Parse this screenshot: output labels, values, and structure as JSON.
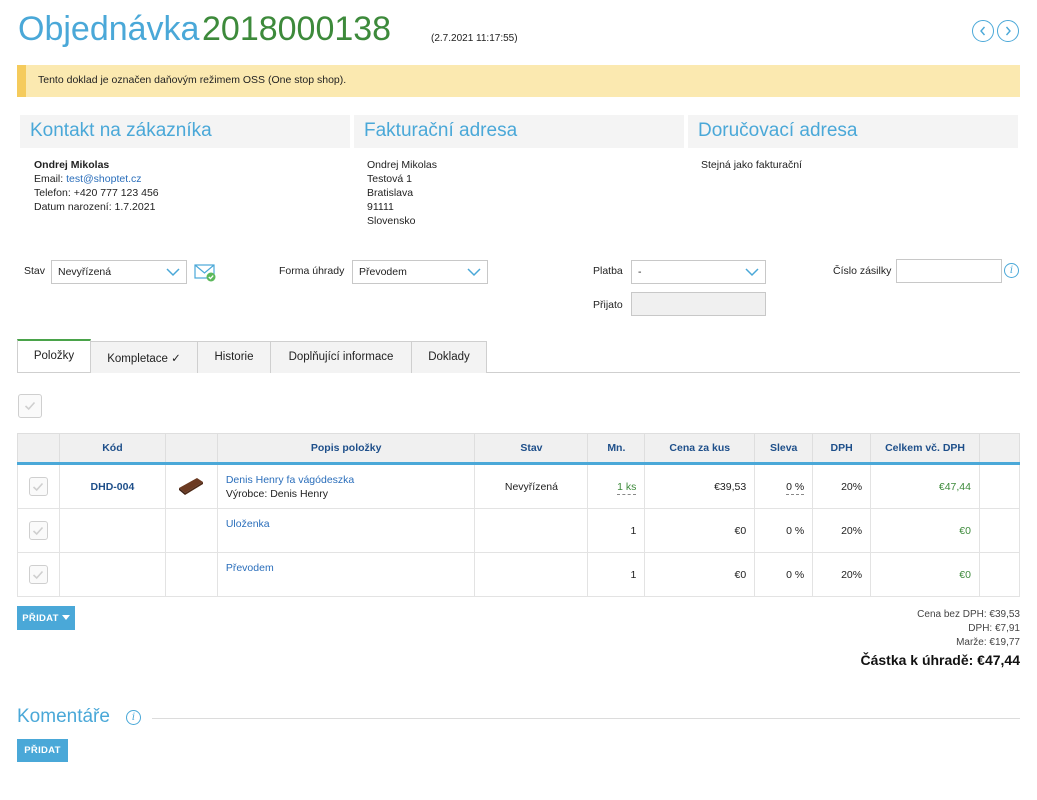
{
  "header": {
    "title_word": "Objednávka",
    "order_number": "2018000138",
    "datetime": "(2.7.2021 11:17:55)"
  },
  "notice": "Tento doklad je označen daňovým režimem OSS (One stop shop).",
  "contact": {
    "heading": "Kontakt na zákazníka",
    "name": "Ondrej Mikolas",
    "email_label": "Email: ",
    "email": "test@shoptet.cz",
    "phone": "Telefon: +420 777 123 456",
    "birth": "Datum narození: 1.7.2021"
  },
  "billing": {
    "heading": "Fakturační adresa",
    "lines": [
      "Ondrej Mikolas",
      "Testová 1",
      "Bratislava",
      "91111",
      "Slovensko"
    ]
  },
  "delivery": {
    "heading": "Doručovací adresa",
    "text": "Stejná jako fakturační"
  },
  "form": {
    "status_label": "Stav",
    "status_value": "Nevyřízená",
    "payment_form_label": "Forma úhrady",
    "payment_form_value": "Převodem",
    "payment_label": "Platba",
    "payment_value": "-",
    "received_label": "Přijato",
    "received_value": "",
    "tracking_label": "Číslo zásilky",
    "tracking_value": ""
  },
  "tabs": [
    "Položky",
    "Kompletace ✓",
    "Historie",
    "Doplňující informace",
    "Doklady"
  ],
  "table": {
    "headers": [
      "",
      "Kód",
      "",
      "Popis položky",
      "Stav",
      "Mn.",
      "Cena za kus",
      "Sleva",
      "DPH",
      "Celkem vč. DPH",
      ""
    ],
    "rows": [
      {
        "code": "DHD-004",
        "name": "Denis Henry fa vágódeszka",
        "maker": "Výrobce: Denis Henry",
        "status": "Nevyřízená",
        "qty": "1 ks",
        "price": "€39,53",
        "discount": "0 %",
        "vat": "20%",
        "total": "€47,44"
      },
      {
        "code": "",
        "name": "Uloženka",
        "maker": "",
        "status": "",
        "qty": "1",
        "price": "€0",
        "discount": "0 %",
        "vat": "20%",
        "total": "€0"
      },
      {
        "code": "",
        "name": "Převodem",
        "maker": "",
        "status": "",
        "qty": "1",
        "price": "€0",
        "discount": "0 %",
        "vat": "20%",
        "total": "€0"
      }
    ]
  },
  "add_button": "PŘIDAT",
  "totals": {
    "net": "Cena bez DPH: €39,53",
    "vat": "DPH: €7,91",
    "margin": "Marže: €19,77",
    "due": "Částka k úhradě: €47,44"
  },
  "comments": {
    "heading": "Komentáře",
    "add_button": "PŘIDAT"
  },
  "colors": {
    "accent": "#4aa8d8",
    "green": "#3d8a3b",
    "notice_bg": "#fbe9b0",
    "notice_border": "#f5cb5c"
  },
  "icons": {
    "prev": "chevron-left-icon",
    "next": "chevron-right-icon",
    "email": "envelope-check-icon",
    "info": "info-icon",
    "checkbox": "checkmark-icon",
    "dropdown": "chevron-down-icon"
  }
}
